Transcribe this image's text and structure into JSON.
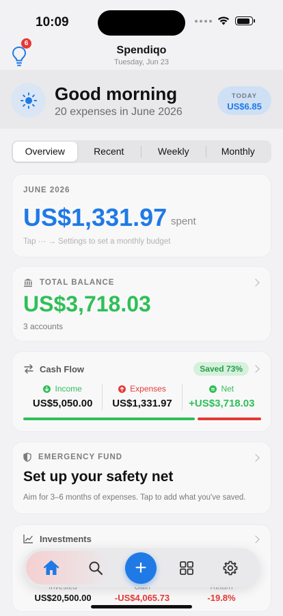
{
  "status_bar": {
    "time": "10:09"
  },
  "header": {
    "app_name": "Spendiqo",
    "date": "Tuesday, Jun 23",
    "tips_badge": "6"
  },
  "greeting": {
    "title": "Good morning",
    "subtitle": "20 expenses in June 2026",
    "today_label": "TODAY",
    "today_value": "US$6.85"
  },
  "tabs": [
    {
      "label": "Overview",
      "active": true
    },
    {
      "label": "Recent",
      "active": false
    },
    {
      "label": "Weekly",
      "active": false
    },
    {
      "label": "Monthly",
      "active": false
    }
  ],
  "month_card": {
    "label": "JUNE 2026",
    "amount": "US$1,331.97",
    "suffix": "spent",
    "hint": "Tap  ···  → Settings to set a monthly budget"
  },
  "balance_card": {
    "label": "TOTAL BALANCE",
    "amount": "US$3,718.03",
    "sub": "3 accounts"
  },
  "cash_flow": {
    "title": "Cash Flow",
    "saved": "Saved 73%",
    "saved_fraction": 0.73,
    "income_label": "Income",
    "income_value": "US$5,050.00",
    "expenses_label": "Expenses",
    "expenses_value": "US$1,331.97",
    "net_label": "Net",
    "net_value": "+US$3,718.03"
  },
  "emergency_fund": {
    "label": "EMERGENCY FUND",
    "title": "Set up your safety net",
    "sub": "Aim for 3–6 months of expenses. Tap to add what you've saved."
  },
  "investments": {
    "title": "Investments",
    "invested_label": "Invested",
    "invested_value": "US$20,500.00",
    "gain_label": "Gain",
    "gain_value": "-US$4,065.73",
    "return_label": "Return",
    "return_value": "-19.8%"
  },
  "colors": {
    "accent": "#1f7ae6",
    "positive": "#2fbf57",
    "negative": "#e53935"
  },
  "tabbar": {
    "icons": [
      "home-icon",
      "search-icon",
      "plus-icon",
      "grid-icon",
      "gear-icon"
    ],
    "fab_symbol": "+"
  }
}
